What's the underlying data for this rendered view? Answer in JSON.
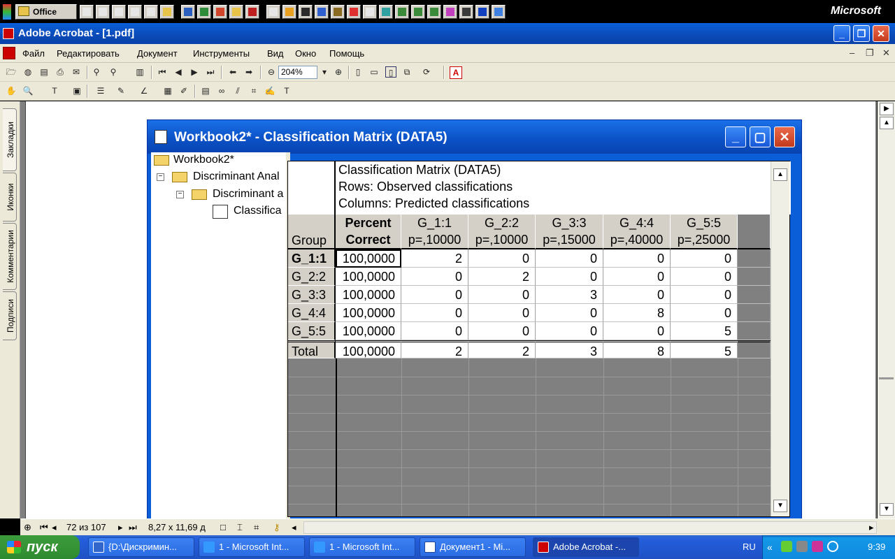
{
  "office_bar": {
    "label": "Office",
    "brand": "Microsoft"
  },
  "acrobat": {
    "title": "Adobe Acrobat - [1.pdf]",
    "menu": [
      "Файл",
      "Редактировать",
      "Документ",
      "Инструменты",
      "Вид",
      "Окно",
      "Помощь"
    ],
    "zoom": "204%",
    "side_tabs": [
      "Закладки",
      "Иконки",
      "Комментарии",
      "Подписи"
    ]
  },
  "workbook": {
    "title": "Workbook2* - Classification Matrix (DATA5)",
    "tree": [
      "Workbook2*",
      "Discriminant Anal",
      "Discriminant a",
      "Classifica"
    ]
  },
  "sheet": {
    "header_lines": [
      "Classification Matrix (DATA5)",
      "Rows: Observed classifications",
      "Columns: Predicted classifications"
    ],
    "corner_label": "Group",
    "columns": [
      {
        "line1": "Percent",
        "line2": "Correct"
      },
      {
        "line1": "G_1:1",
        "line2": "p=,10000"
      },
      {
        "line1": "G_2:2",
        "line2": "p=,10000"
      },
      {
        "line1": "G_3:3",
        "line2": "p=,15000"
      },
      {
        "line1": "G_4:4",
        "line2": "p=,40000"
      },
      {
        "line1": "G_5:5",
        "line2": "p=,25000"
      }
    ],
    "rows": [
      {
        "label": "G_1:1",
        "values": [
          "100,0000",
          "2",
          "0",
          "0",
          "0",
          "0"
        ]
      },
      {
        "label": "G_2:2",
        "values": [
          "100,0000",
          "0",
          "2",
          "0",
          "0",
          "0"
        ]
      },
      {
        "label": "G_3:3",
        "values": [
          "100,0000",
          "0",
          "0",
          "3",
          "0",
          "0"
        ]
      },
      {
        "label": "G_4:4",
        "values": [
          "100,0000",
          "0",
          "0",
          "0",
          "8",
          "0"
        ]
      },
      {
        "label": "G_5:5",
        "values": [
          "100,0000",
          "0",
          "0",
          "0",
          "0",
          "5"
        ]
      },
      {
        "label": "Total",
        "values": [
          "100,0000",
          "2",
          "2",
          "3",
          "8",
          "5"
        ]
      }
    ]
  },
  "status": {
    "page": "72 из 107",
    "size": "8,27 x 11,69 д"
  },
  "taskbar": {
    "start": "пуск",
    "tasks": [
      "{D:\\Дискримин...",
      "1 - Microsoft Int...",
      "1 - Microsoft Int...",
      "Документ1 - Mi...",
      "Adobe Acrobat -..."
    ],
    "lang": "RU",
    "clock": "9:39"
  }
}
